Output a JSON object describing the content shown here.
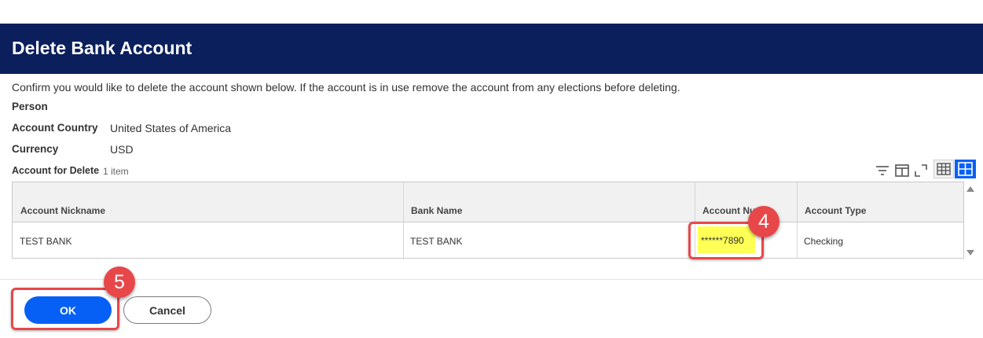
{
  "header": {
    "title": "Delete Bank Account"
  },
  "intro": "Confirm you would like to delete the account shown below.  If the account is in use remove the account from any elections before deleting.",
  "fields": {
    "person_label": "Person",
    "country_label": "Account Country",
    "country_value": "United States of America",
    "currency_label": "Currency",
    "currency_value": "USD"
  },
  "grid": {
    "title": "Account for Delete",
    "count": "1 item",
    "columns": [
      "Account Nickname",
      "Bank Name",
      "Account Nu",
      "Account Type"
    ],
    "rows": [
      [
        "TEST BANK",
        "TEST BANK",
        "******7890",
        "Checking"
      ]
    ],
    "toolbar_icons": [
      "filter-icon",
      "column-chooser-icon",
      "expand-icon",
      "table-view-icon",
      "grid-view-icon"
    ]
  },
  "callouts": {
    "account_number": "4",
    "ok_button": "5"
  },
  "buttons": {
    "ok": "OK",
    "cancel": "Cancel"
  },
  "colors": {
    "header_bg": "#0b1f5c",
    "primary": "#0760f6",
    "callout": "#e8474a",
    "highlight": "#ffff55"
  }
}
